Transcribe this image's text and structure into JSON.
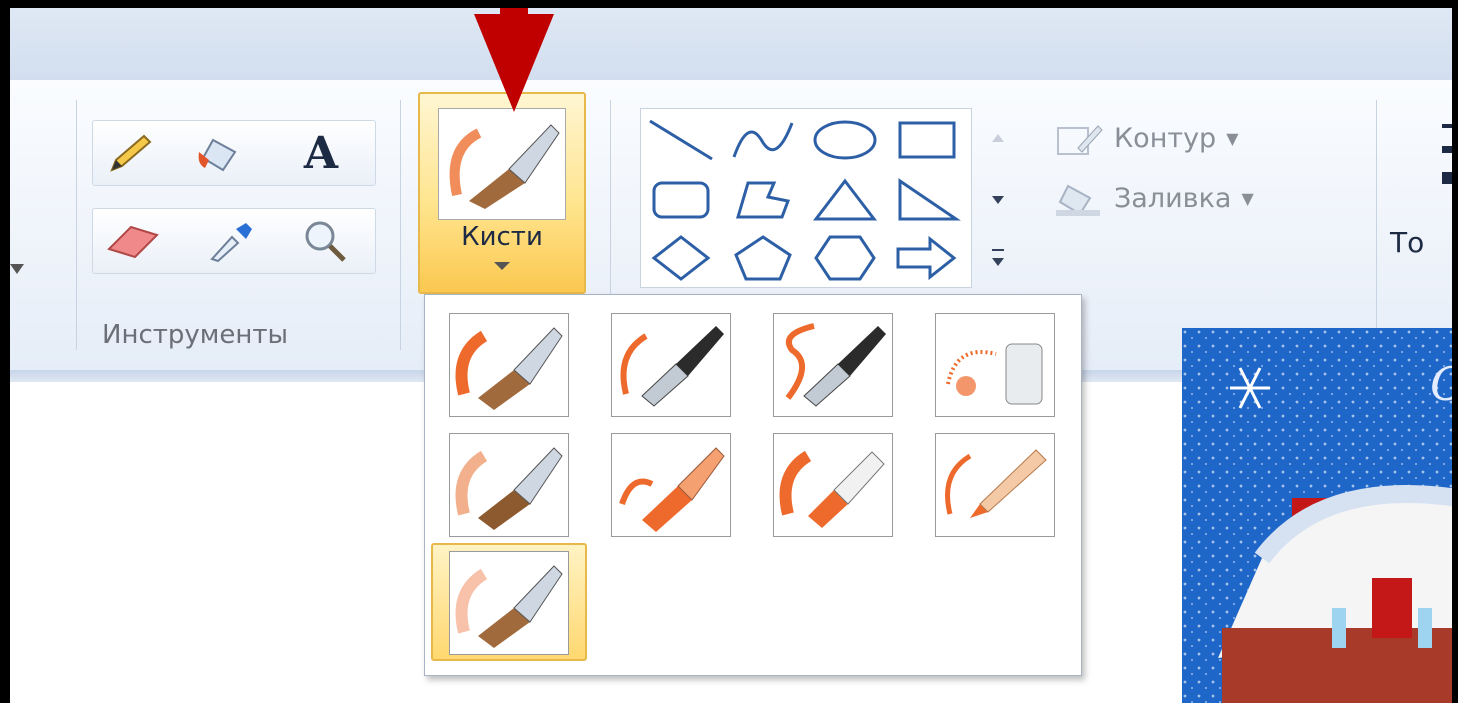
{
  "toolbar": {
    "tools_group_label": "Инструменты",
    "tools": [
      {
        "icon": "pencil-icon"
      },
      {
        "icon": "fill-bucket-icon"
      },
      {
        "icon": "text-icon",
        "glyph": "A"
      },
      {
        "icon": "eraser-icon"
      },
      {
        "icon": "color-picker-icon"
      },
      {
        "icon": "magnifier-icon"
      }
    ],
    "brushes_label": "Кисти",
    "outline_label": "Контур",
    "fill_label": "Заливка",
    "thickness_label_partial": "То"
  },
  "brushes_dropdown": {
    "items": [
      {
        "name": "brush-icon"
      },
      {
        "name": "calligraphy-brush-1-icon"
      },
      {
        "name": "calligraphy-brush-2-icon"
      },
      {
        "name": "airbrush-icon"
      },
      {
        "name": "oil-brush-icon"
      },
      {
        "name": "crayon-icon"
      },
      {
        "name": "marker-icon"
      },
      {
        "name": "natural-pencil-icon"
      },
      {
        "name": "watercolor-brush-icon",
        "selected": true
      }
    ]
  },
  "colors": {
    "accent_arrow": "#c00000",
    "selection": "#ffd870",
    "ribbon": "#eef3fa"
  }
}
